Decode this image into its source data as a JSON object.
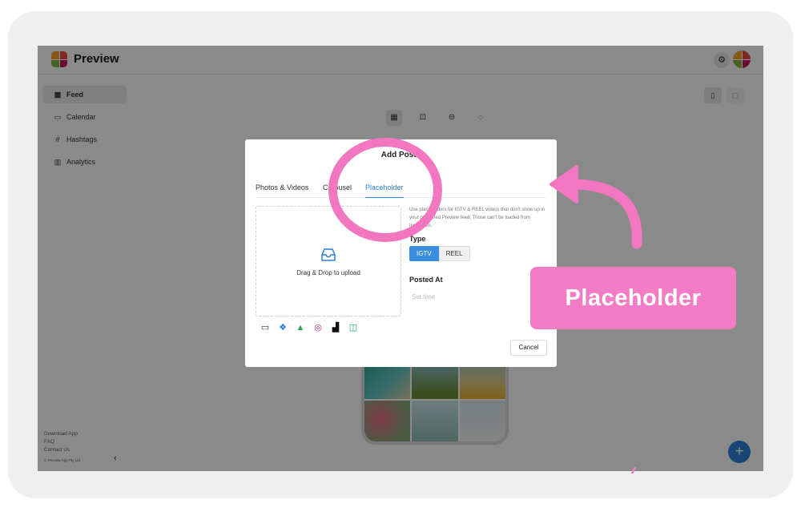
{
  "app": {
    "brand": "Preview"
  },
  "sidebar": {
    "items": [
      {
        "label": "Feed",
        "icon": "grid-icon"
      },
      {
        "label": "Calendar",
        "icon": "calendar-icon"
      },
      {
        "label": "Hashtags",
        "icon": "hashtag-icon"
      },
      {
        "label": "Analytics",
        "icon": "bar-chart-icon"
      }
    ],
    "footer": [
      "Download App",
      "FAQ",
      "Contact Us"
    ],
    "copyright": "© Preview App Pty Ltd"
  },
  "modal": {
    "title": "Add Posts",
    "tabs": [
      "Photos & Videos",
      "Carousel",
      "Placeholder"
    ],
    "dropzone_text": "Drag & Drop to upload",
    "info_text": "Use placeholders for IGTV & REEL videos that don't show up in your published Preview feed. Those can't be loaded from Instagram.",
    "type_label": "Type",
    "type_options": [
      "IGTV",
      "REEL"
    ],
    "posted_at_label": "Posted At",
    "set_time_placeholder": "Set time",
    "cancel_label": "Cancel"
  },
  "callout": {
    "text": "Placeholder"
  },
  "colors": {
    "accent": "#2d7fd3",
    "highlight": "#f277c0"
  }
}
